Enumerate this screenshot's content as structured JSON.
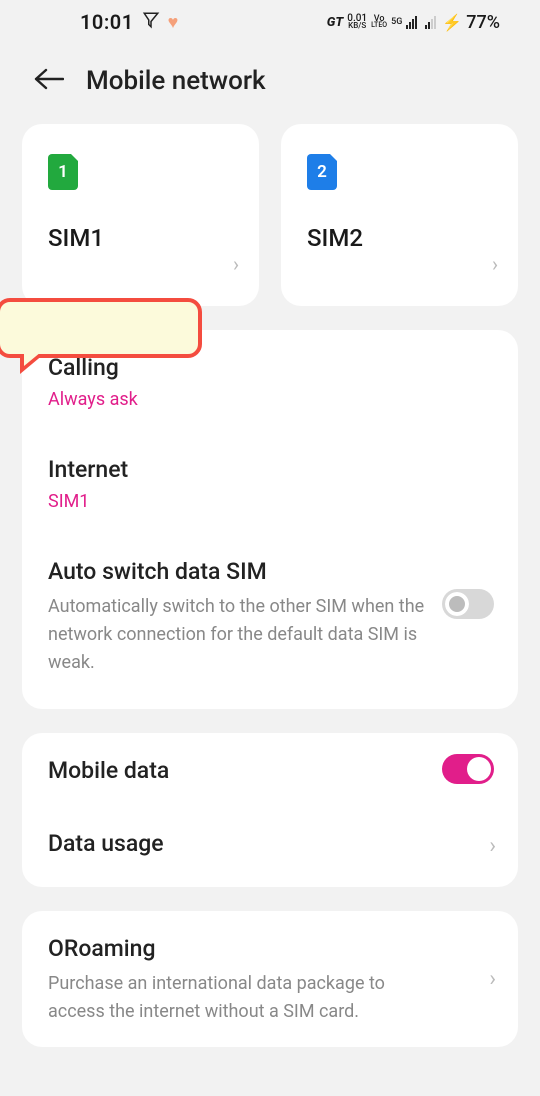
{
  "status": {
    "time": "10:01",
    "gt": "GT",
    "net_speed": "0.01",
    "net_unit": "KB/S",
    "vo": "Vo",
    "lte": "LTEO",
    "g5": "5G",
    "battery_pct": "77%"
  },
  "header": {
    "title": "Mobile network"
  },
  "sims": [
    {
      "badge": "1",
      "name": "SIM1",
      "color": "green"
    },
    {
      "badge": "2",
      "name": "SIM2",
      "color": "blue"
    }
  ],
  "defaults": {
    "calling_title": "Calling",
    "calling_value": "Always ask",
    "internet_title": "Internet",
    "internet_value": "SIM1",
    "autoswitch_title": "Auto switch data SIM",
    "autoswitch_desc": "Automatically switch to the other SIM when the network connection for the default data SIM is weak.",
    "autoswitch_on": false
  },
  "data": {
    "mobile_data_title": "Mobile data",
    "mobile_data_on": true,
    "data_usage_title": "Data usage"
  },
  "roaming": {
    "title": "ORoaming",
    "desc": "Purchase an international data package to access the internet without a SIM card."
  }
}
